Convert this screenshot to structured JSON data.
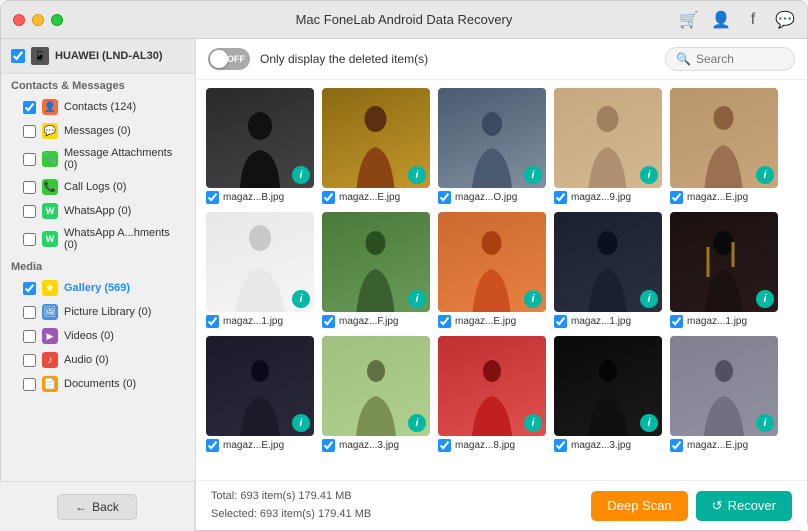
{
  "window": {
    "title": "Mac FoneLab Android Data Recovery"
  },
  "titleIcons": [
    "cart-icon",
    "user-icon",
    "facebook-icon",
    "chat-icon"
  ],
  "device": {
    "name": "HUAWEI (LND-AL30)",
    "checked": true
  },
  "sidebar": {
    "sections": [
      {
        "label": "Contacts & Messages",
        "items": [
          {
            "id": "contacts",
            "label": "Contacts (124)",
            "iconType": "contacts",
            "icon": "👤",
            "checked": true
          },
          {
            "id": "messages",
            "label": "Messages (0)",
            "iconType": "messages",
            "icon": "💬",
            "checked": false
          },
          {
            "id": "msg-attach",
            "label": "Message Attachments (0)",
            "iconType": "msg-attach",
            "icon": "📎",
            "checked": false
          },
          {
            "id": "call-logs",
            "label": "Call Logs (0)",
            "iconType": "call",
            "icon": "📞",
            "checked": false
          },
          {
            "id": "whatsapp",
            "label": "WhatsApp (0)",
            "iconType": "whatsapp",
            "icon": "W",
            "checked": false
          },
          {
            "id": "whatsapp-attach",
            "label": "WhatsApp A...hments (0)",
            "iconType": "whatsapp2",
            "icon": "W",
            "checked": false
          }
        ]
      },
      {
        "label": "Media",
        "items": [
          {
            "id": "gallery",
            "label": "Gallery (569)",
            "iconType": "gallery",
            "icon": "★",
            "checked": true,
            "active": true
          },
          {
            "id": "pic-lib",
            "label": "Picture Library (0)",
            "iconType": "pic-lib",
            "icon": "🖼",
            "checked": false
          },
          {
            "id": "videos",
            "label": "Videos (0)",
            "iconType": "videos",
            "icon": "▶",
            "checked": false
          },
          {
            "id": "audio",
            "label": "Audio (0)",
            "iconType": "audio",
            "icon": "♪",
            "checked": false
          },
          {
            "id": "documents",
            "label": "Documents (0)",
            "iconType": "docs",
            "icon": "📄",
            "checked": false
          }
        ]
      }
    ]
  },
  "toolbar": {
    "toggle_state": "OFF",
    "only_deleted_text": "Only display the deleted item(s)",
    "search_placeholder": "Search"
  },
  "photos": {
    "rows": [
      [
        {
          "label": "magaz...B.jpg",
          "color": "figure-dark"
        },
        {
          "label": "magaz...E.jpg",
          "color": "figure-brown"
        },
        {
          "label": "magaz...O.jpg",
          "color": "figure-blue-gray"
        },
        {
          "label": "magaz...9.jpg",
          "color": "figure-beige"
        },
        {
          "label": "magaz...E.jpg",
          "color": "figure-beige2"
        }
      ],
      [
        {
          "label": "magaz...1.jpg",
          "color": "figure-wedding"
        },
        {
          "label": "magaz...F.jpg",
          "color": "figure-green"
        },
        {
          "label": "magaz...E.jpg",
          "color": "figure-orange"
        },
        {
          "label": "magaz...1.jpg",
          "color": "figure-dark2"
        },
        {
          "label": "magaz...1.jpg",
          "color": "figure-candle"
        }
      ],
      [
        {
          "label": "magaz...E.jpg",
          "color": "figure-dark3"
        },
        {
          "label": "magaz...3.jpg",
          "color": "figure-green2"
        },
        {
          "label": "magaz...8.jpg",
          "color": "figure-red"
        },
        {
          "label": "magaz...3.jpg",
          "color": "figure-dark4"
        },
        {
          "label": "magaz...E.jpg",
          "color": "figure-gray"
        }
      ]
    ]
  },
  "status": {
    "total": "Total: 693 item(s) 179.41 MB",
    "selected": "Selected: 693 item(s) 179.41 MB"
  },
  "buttons": {
    "back": "Back",
    "deep_scan": "Deep Scan",
    "recover": "Recover"
  }
}
